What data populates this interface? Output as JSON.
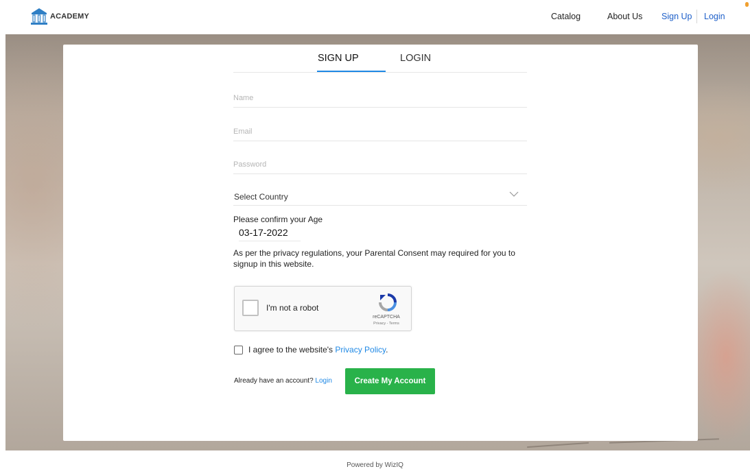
{
  "brand": {
    "name": "ACADEMY"
  },
  "nav": {
    "items": [
      {
        "label": "Catalog"
      },
      {
        "label": "About Us"
      },
      {
        "label": "Sign Up"
      },
      {
        "label": "Login"
      }
    ]
  },
  "tabs": [
    {
      "label": "SIGN UP",
      "active": true
    },
    {
      "label": "LOGIN",
      "active": false
    }
  ],
  "form": {
    "name_placeholder": "Name",
    "email_placeholder": "Email",
    "password_placeholder": "Password",
    "country_value": "Select Country",
    "age_label": "Please confirm your Age",
    "age_value": "03-17-2022",
    "consent_text": "As per the privacy regulations, your Parental Consent may required for you to signup in this website.",
    "recaptcha_label": "I'm not a robot",
    "recaptcha_brand": "reCAPTCHA",
    "recaptcha_terms": "Privacy - Terms",
    "agree_prefix": "I agree to the website's ",
    "agree_link": "Privacy Policy",
    "agree_suffix": ".",
    "already_text": "Already have an account?",
    "already_link": "Login",
    "submit_label": "Create My Account"
  },
  "footer": {
    "text": "Powered by WizIQ"
  },
  "colors": {
    "accent": "#1e88e5",
    "primary_button": "#29b24a",
    "nav_active": "#1d5fc9"
  }
}
